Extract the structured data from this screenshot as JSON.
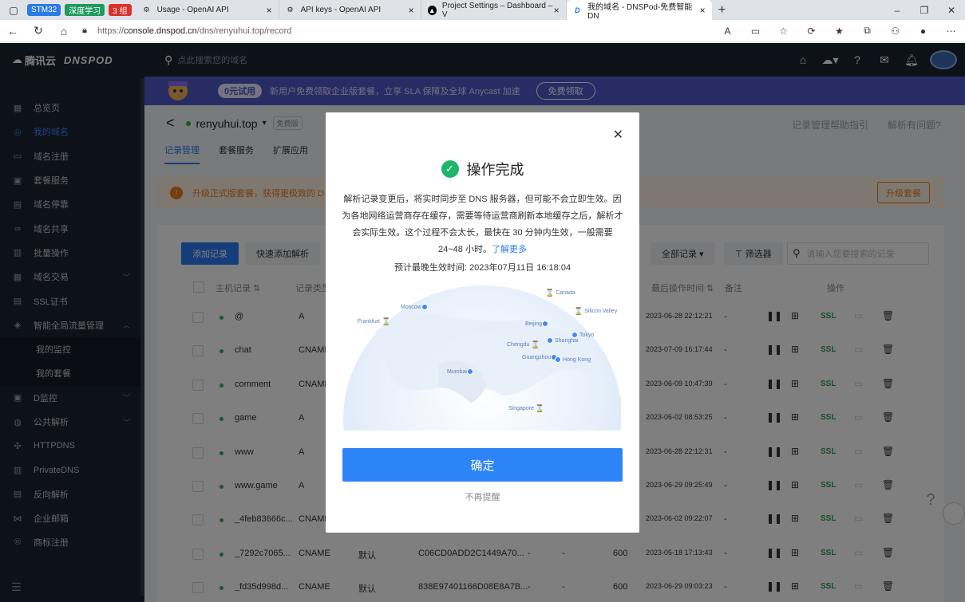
{
  "browser": {
    "tab_groups": [
      {
        "label": "STM32",
        "color": "#2b7be4"
      },
      {
        "label": "深度学习",
        "color": "#1e9a5c"
      },
      {
        "label": "3 组",
        "color": "#d9342b"
      }
    ],
    "tabs": [
      {
        "title": "Usage - OpenAI API",
        "icon": "openai-icon"
      },
      {
        "title": "API keys - OpenAI API",
        "icon": "openai-icon"
      },
      {
        "title": "Project Settings – Dashboard – V",
        "icon": "vercel-icon"
      },
      {
        "title": "我的域名 - DNSPod-免费智能DN",
        "icon": "dnspod-icon"
      }
    ],
    "url_prefix": "https://",
    "url_host": "console.dnspod.cn",
    "url_path": "/dns/renyuhui.top/record"
  },
  "brand": {
    "name": "腾讯云",
    "product": "DNSPOD"
  },
  "header": {
    "search_placeholder": "点此搜索您的域名"
  },
  "sidebar": {
    "items": [
      {
        "label": "总览页",
        "icon": "grid-icon"
      },
      {
        "label": "我的域名",
        "icon": "globe-icon",
        "active": true
      },
      {
        "label": "域名注册",
        "icon": "register-icon"
      },
      {
        "label": "套餐服务",
        "icon": "package-icon"
      },
      {
        "label": "域名停靠",
        "icon": "parking-icon"
      },
      {
        "label": "域名共享",
        "icon": "share-icon"
      },
      {
        "label": "批量操作",
        "icon": "batch-icon"
      },
      {
        "label": "域名交易",
        "icon": "trade-icon",
        "arrow": "down"
      },
      {
        "label": "SSL证书",
        "icon": "ssl-icon"
      },
      {
        "label": "智能全局流量管理",
        "icon": "traffic-icon",
        "arrow": "up"
      }
    ],
    "sub_items": [
      {
        "label": "我的监控"
      },
      {
        "label": "我的套餐"
      }
    ],
    "items_after": [
      {
        "label": "D监控",
        "icon": "monitor-icon",
        "arrow": "down"
      },
      {
        "label": "公共解析",
        "icon": "public-dns-icon",
        "arrow": "down"
      },
      {
        "label": "HTTPDNS",
        "icon": "httpdns-icon"
      },
      {
        "label": "PrivateDNS",
        "icon": "private-dns-icon"
      },
      {
        "label": "反向解析",
        "icon": "reverse-icon"
      },
      {
        "label": "企业邮箱",
        "icon": "mail-icon"
      },
      {
        "label": "商标注册",
        "icon": "trademark-icon"
      }
    ]
  },
  "promo": {
    "tag": "0元试用",
    "text": "新用户免费领取企业版套餐，立享 SLA 保障及全球 Anycast 加速",
    "button": "免费领取"
  },
  "domain": {
    "name": "renyuhui.top",
    "badge": "免费版"
  },
  "help_links": [
    "记录管理帮助指引",
    "解析有问题?"
  ],
  "content_tabs": [
    "记录管理",
    "套餐服务",
    "扩展应用"
  ],
  "notice": {
    "text": "升级正式版套餐，获得更极致的 D",
    "button": "升级套餐"
  },
  "toolbar": {
    "add": "添加记录",
    "quick_add": "快速添加解析",
    "all_records": "全部记录",
    "filter": "筛选器",
    "search_placeholder": "请输入您要搜索的记录"
  },
  "table": {
    "columns": [
      "主机记录",
      "记录类型",
      "最后操作时间",
      "备注",
      "操作"
    ],
    "rows": [
      {
        "host": "@",
        "type": "A",
        "line": "",
        "value": "",
        "ttl": "",
        "time": "2023-06-28 22:12:21",
        "note": "-"
      },
      {
        "host": "chat",
        "type": "CNAME",
        "line": "",
        "value": "",
        "ttl": "",
        "time": "2023-07-09 16:17:44",
        "note": "-"
      },
      {
        "host": "comment",
        "type": "CNAME",
        "line": "",
        "value": "",
        "ttl": "",
        "time": "2023-06-09 10:47:39",
        "note": "-"
      },
      {
        "host": "game",
        "type": "A",
        "line": "",
        "value": "",
        "ttl": "",
        "time": "2023-06-02 08:53:25",
        "note": "-"
      },
      {
        "host": "www",
        "type": "A",
        "line": "",
        "value": "",
        "ttl": "",
        "time": "2023-06-28 22:12:31",
        "note": "-"
      },
      {
        "host": "www.game",
        "type": "A",
        "line": "",
        "value": "",
        "ttl": "",
        "time": "2023-06-29 09:25:49",
        "note": "-"
      },
      {
        "host": "_4feb83666c...",
        "type": "CNAME",
        "line": "",
        "value": "",
        "ttl": "",
        "time": "2023-06-02 09:22:07",
        "note": "-"
      },
      {
        "host": "_7292c7065...",
        "type": "CNAME",
        "line": "默认",
        "value": "C06CD0ADD2C1449A70...",
        "ttl": "600",
        "time": "2023-05-18 17:13:43",
        "note": "-",
        "dash1": "-",
        "dash2": "-"
      },
      {
        "host": "_fd35d998d...",
        "type": "CNAME",
        "line": "默认",
        "value": "838E97401166D08E8A7B...",
        "ttl": "600",
        "time": "2023-06-29 09:03:23",
        "note": "-",
        "dash1": "-",
        "dash2": "-"
      }
    ],
    "action_ssl": "SSL"
  },
  "modal": {
    "title": "操作完成",
    "body": "解析记录变更后，将实时同步至 DNS 服务器，但可能不会立即生效。因为各地网络运营商存在缓存，需要等待运营商刷新本地缓存之后，解析才会实际生效。这个过程不会太长，最快在 30 分钟内生效，一般需要 24~48 小时。",
    "learn_more": "了解更多",
    "eta_label": "预计最晚生效时间:",
    "eta_value": "2023年07月11日 16:18:04",
    "cities": [
      "Canada",
      "Moscow",
      "Silicon Valley",
      "Frankfurt",
      "Beijing",
      "Tokyo",
      "Chengdu",
      "Shanghai",
      "Guangzhou",
      "Hong Kong",
      "Mumbai",
      "Singapore"
    ],
    "confirm": "确定",
    "dont_remind": "不再提醒"
  }
}
